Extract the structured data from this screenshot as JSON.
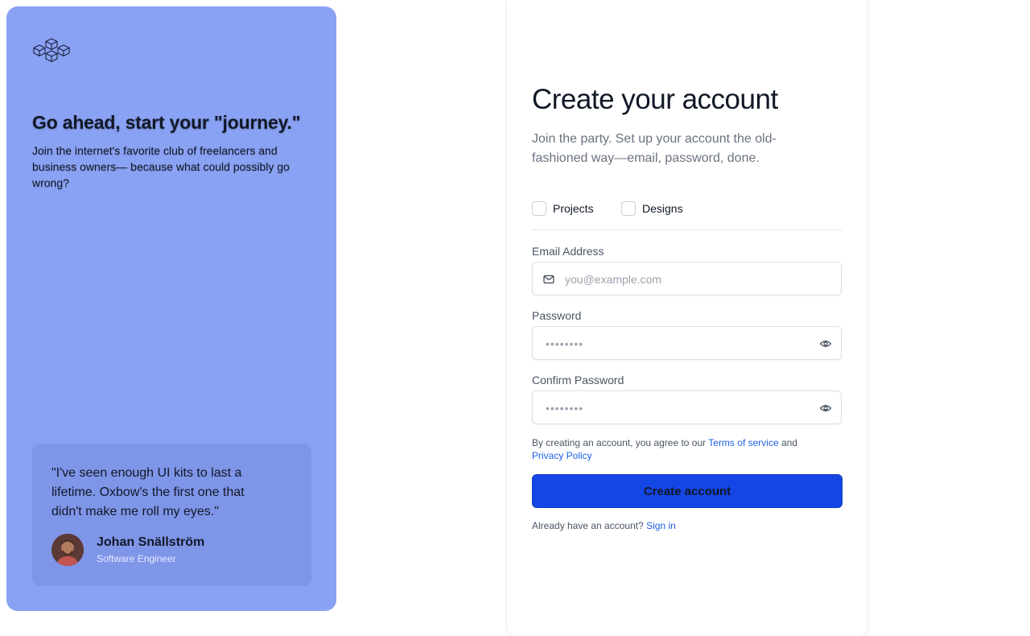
{
  "hero": {
    "title": "Go ahead, start your \"journey.\"",
    "subtitle": "Join the internet's favorite club of freelancers and business owners— because what could possibly go wrong?",
    "logo_icon": "cubes-logo-icon"
  },
  "testimonial": {
    "quote": "\"I've seen enough UI kits to last a lifetime. Oxbow's the first one that didn't make me roll my eyes.\"",
    "name": "Johan Snällström",
    "role": "Software Engineer"
  },
  "form": {
    "title": "Create your account",
    "subtitle": "Join the party. Set up your account the old-fashioned way—email, password, done.",
    "checkboxes": [
      {
        "label": "Projects",
        "checked": false
      },
      {
        "label": "Designs",
        "checked": false
      }
    ],
    "email": {
      "label": "Email Address",
      "placeholder": "you@example.com",
      "icon": "mail-icon"
    },
    "password": {
      "label": "Password",
      "placeholder": "••••••••",
      "icon": "eye-icon"
    },
    "confirm_password": {
      "label": "Confirm Password",
      "placeholder": "••••••••",
      "icon": "eye-icon"
    },
    "terms": {
      "prefix": "By creating an account, you agree to our ",
      "terms_link": "Terms of service",
      "middle": " and",
      "privacy_link": "Privacy Policy"
    },
    "submit_label": "Create account",
    "signin": {
      "prefix": "Already have an account? ",
      "link": "Sign in"
    }
  },
  "colors": {
    "panel": "#8aa2f3",
    "testimonial_bg": "#7f95e8",
    "primary_button": "#1446e5",
    "link": "#1d5fe6"
  }
}
